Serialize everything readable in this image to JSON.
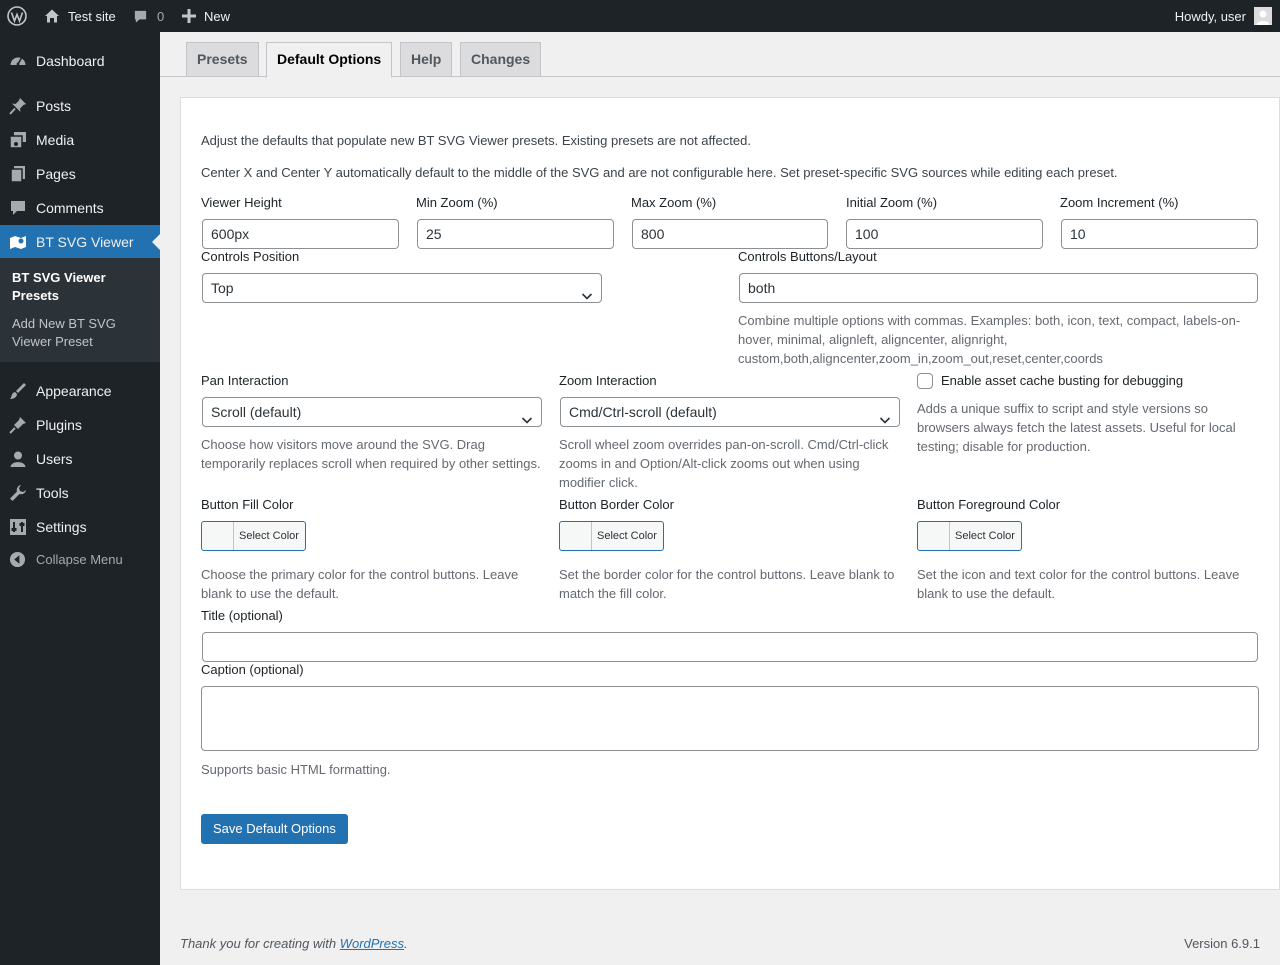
{
  "adminbar": {
    "site_name": "Test site",
    "comments_count": "0",
    "new_label": "New",
    "greeting": "Howdy, user"
  },
  "sidebar": {
    "items": [
      {
        "label": "Dashboard",
        "icon": "dashboard-icon"
      },
      {
        "label": "Posts",
        "icon": "pin-icon"
      },
      {
        "label": "Media",
        "icon": "media-icon"
      },
      {
        "label": "Pages",
        "icon": "pages-icon"
      },
      {
        "label": "Comments",
        "icon": "comment-icon"
      },
      {
        "label": "BT SVG Viewer",
        "icon": "map-icon"
      },
      {
        "label": "Appearance",
        "icon": "brush-icon"
      },
      {
        "label": "Plugins",
        "icon": "plugin-icon"
      },
      {
        "label": "Users",
        "icon": "user-icon"
      },
      {
        "label": "Tools",
        "icon": "wrench-icon"
      },
      {
        "label": "Settings",
        "icon": "settings-icon"
      }
    ],
    "submenu": {
      "presets": "BT SVG Viewer Presets",
      "add_new": "Add New BT SVG Viewer Preset"
    },
    "collapse": "Collapse Menu"
  },
  "tabs": [
    "Presets",
    "Default Options",
    "Help",
    "Changes"
  ],
  "intro": {
    "line1": "Adjust the defaults that populate new BT SVG Viewer presets. Existing presets are not affected.",
    "line2": "Center X and Center Y automatically default to the middle of the SVG and are not configurable here. Set preset-specific SVG sources while editing each preset."
  },
  "fields": {
    "viewer_height": {
      "label": "Viewer Height",
      "value": "600px"
    },
    "min_zoom": {
      "label": "Min Zoom (%)",
      "value": "25"
    },
    "max_zoom": {
      "label": "Max Zoom (%)",
      "value": "800"
    },
    "initial_zoom": {
      "label": "Initial Zoom (%)",
      "value": "100"
    },
    "zoom_increment": {
      "label": "Zoom Increment (%)",
      "value": "10"
    },
    "controls_position": {
      "label": "Controls Position",
      "value": "Top"
    },
    "controls_buttons": {
      "label": "Controls Buttons/Layout",
      "value": "both",
      "desc": "Combine multiple options with commas. Examples: both, icon, text, compact, labels-on-hover, minimal, alignleft, aligncenter, alignright, custom,both,aligncenter,zoom_in,zoom_out,reset,center,coords"
    },
    "pan_interaction": {
      "label": "Pan Interaction",
      "value": "Scroll (default)",
      "desc": "Choose how visitors move around the SVG. Drag temporarily replaces scroll when required by other settings."
    },
    "zoom_interaction": {
      "label": "Zoom Interaction",
      "value": "Cmd/Ctrl-scroll (default)",
      "desc": "Scroll wheel zoom overrides pan-on-scroll. Cmd/Ctrl-click zooms in and Option/Alt-click zooms out when using modifier click."
    },
    "cache_busting": {
      "label": "Enable asset cache busting for debugging",
      "desc": "Adds a unique suffix to script and style versions so browsers always fetch the latest assets. Useful for local testing; disable for production."
    },
    "fill_color": {
      "label": "Button Fill Color",
      "button": "Select Color",
      "desc": "Choose the primary color for the control buttons. Leave blank to use the default."
    },
    "border_color": {
      "label": "Button Border Color",
      "button": "Select Color",
      "desc": "Set the border color for the control buttons. Leave blank to match the fill color."
    },
    "foreground_color": {
      "label": "Button Foreground Color",
      "button": "Select Color",
      "desc": "Set the icon and text color for the control buttons. Leave blank to use the default."
    },
    "title": {
      "label": "Title (optional)",
      "value": ""
    },
    "caption": {
      "label": "Caption (optional)",
      "value": "",
      "desc": "Supports basic HTML formatting."
    }
  },
  "save_button": "Save Default Options",
  "footer": {
    "thanks_prefix": "Thank you for creating with ",
    "thanks_link": "WordPress",
    "thanks_suffix": ".",
    "version": "Version 6.9.1"
  },
  "colors": {
    "accent": "#2271b1",
    "adminbar_bg": "#1d2327",
    "submenu_bg": "#2c3338"
  }
}
